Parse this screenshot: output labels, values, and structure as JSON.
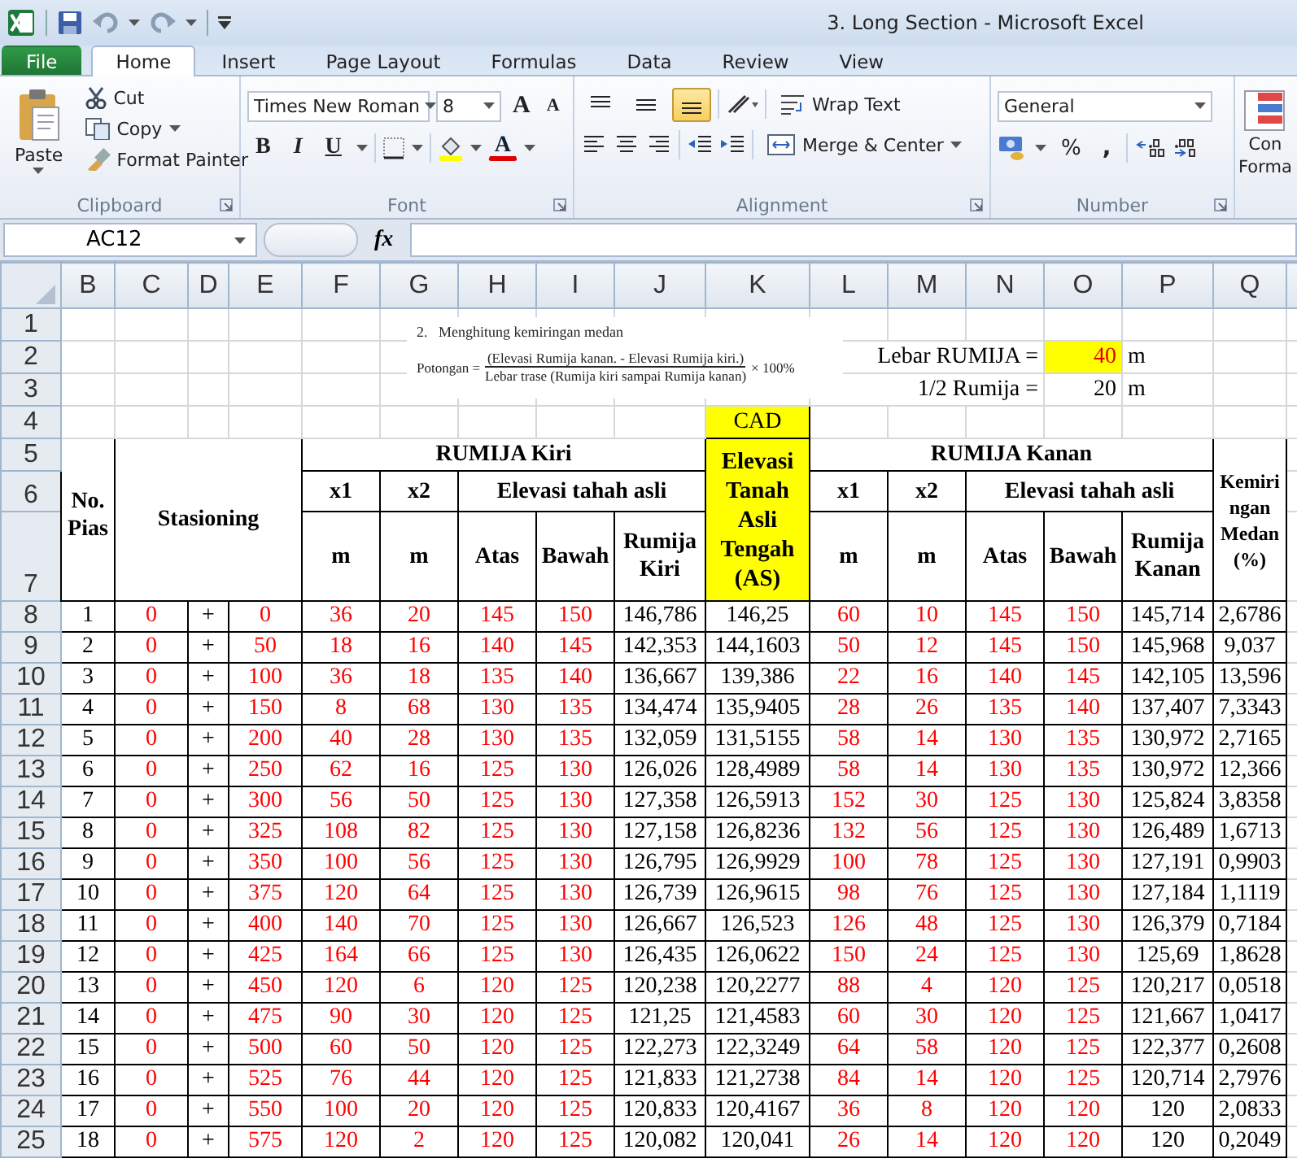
{
  "window": {
    "title": "3. Long Section  -  Microsoft Excel"
  },
  "menu_tabs": [
    {
      "label": "File",
      "kind": "file",
      "selected": false
    },
    {
      "label": "Home",
      "kind": "tab",
      "selected": true
    },
    {
      "label": "Insert",
      "kind": "tab",
      "selected": false
    },
    {
      "label": "Page Layout",
      "kind": "tab",
      "selected": false
    },
    {
      "label": "Formulas",
      "kind": "tab",
      "selected": false
    },
    {
      "label": "Data",
      "kind": "tab",
      "selected": false
    },
    {
      "label": "Review",
      "kind": "tab",
      "selected": false
    },
    {
      "label": "View",
      "kind": "tab",
      "selected": false
    }
  ],
  "ribbon": {
    "clipboard": {
      "label": "Clipboard",
      "paste": "Paste",
      "cut": "Cut",
      "copy": "Copy",
      "format_painter": "Format Painter"
    },
    "font": {
      "label": "Font",
      "font_name": "Times New Roman",
      "font_size": "8",
      "grow": "A",
      "shrink": "A",
      "styles": [
        {
          "kind": "bold",
          "label": "B"
        },
        {
          "kind": "italic",
          "label": "I"
        },
        {
          "kind": "underline",
          "label": "U"
        }
      ],
      "font_color": "A"
    },
    "alignment": {
      "label": "Alignment",
      "vertical": [
        {
          "kind": "top",
          "selected": false
        },
        {
          "kind": "middle",
          "selected": false
        },
        {
          "kind": "bottom",
          "selected": true
        }
      ],
      "wrap_text": "Wrap Text",
      "merge_center": "Merge & Center"
    },
    "number": {
      "label": "Number",
      "format": "General",
      "percent": "%",
      "comma": ","
    },
    "styles": {
      "conditional_lines": [
        "Con",
        "Forma"
      ]
    }
  },
  "formula_bar": {
    "name_box": "AC12",
    "function_label": "fx"
  },
  "sheet": {
    "columns": [
      {
        "letter": "B",
        "color": "#000000"
      },
      {
        "letter": "C",
        "color": "#ff0000"
      },
      {
        "letter": "D",
        "color": "#000000"
      },
      {
        "letter": "E",
        "color": "#ff0000"
      },
      {
        "letter": "F",
        "color": "#ff0000"
      },
      {
        "letter": "G",
        "color": "#ff0000"
      },
      {
        "letter": "H",
        "color": "#ff0000"
      },
      {
        "letter": "I",
        "color": "#ff0000"
      },
      {
        "letter": "J",
        "color": "#000000"
      },
      {
        "letter": "K",
        "color": "#000000"
      },
      {
        "letter": "L",
        "color": "#ff0000"
      },
      {
        "letter": "M",
        "color": "#ff0000"
      },
      {
        "letter": "N",
        "color": "#ff0000"
      },
      {
        "letter": "O",
        "color": "#ff0000"
      },
      {
        "letter": "P",
        "color": "#000000"
      },
      {
        "letter": "Q",
        "color": "#000000"
      }
    ],
    "row_numbers": [
      "1",
      "2",
      "3",
      "4",
      "5",
      "6",
      "7",
      "8",
      "9",
      "10",
      "11",
      "12",
      "13",
      "14",
      "15",
      "16",
      "17",
      "18",
      "19",
      "20",
      "21",
      "22",
      "23",
      "24",
      "25"
    ],
    "formula_picture": {
      "heading": "2.   Menghitung kemiringan medan",
      "lhs": "Potongan =",
      "numerator": "(Elevasi Rumija kanan. - Elevasi Rumija kiri.)",
      "denominator": "Lebar trase (Rumija kiri sampai Rumija kanan)",
      "factor": "× 100%"
    },
    "parameters": [
      {
        "label": "Lebar RUMIJA =",
        "value": "40",
        "unit": "m",
        "highlighted": true
      },
      {
        "label": "1/2 Rumija =",
        "value": "20",
        "unit": "m",
        "highlighted": false
      }
    ],
    "cad_label": "CAD",
    "header": {
      "no": "No. Pias",
      "station": "Stasioning",
      "left_group": "RUMIJA Kiri",
      "right_group": "RUMIJA Kanan",
      "x1_left": "x1",
      "x2_left": "x2",
      "x1_right": "x1",
      "x2_right": "x2",
      "elevation_left": "Elevasi tahah asli",
      "elevation_right": "Elevasi tahah asli",
      "unit_left_x1": "m",
      "unit_left_x2": "m",
      "unit_right_x1": "m",
      "unit_right_x2": "m",
      "top_left": "Atas",
      "bottom_left": "Bawah",
      "rumija_left": "Rumija Kiri",
      "top_right": "Atas",
      "bottom_right": "Bawah",
      "rumija_right": "Rumija Kanan",
      "center": "Elevasi Tanah Asli Tengah (AS)",
      "center_highlighted": true,
      "slope": "Kemiringan Medan (%)"
    },
    "rows": [
      [
        "1",
        "0",
        "+",
        "0",
        "36",
        "20",
        "145",
        "150",
        "146,786",
        "146,25",
        "60",
        "10",
        "145",
        "150",
        "145,714",
        "2,6786"
      ],
      [
        "2",
        "0",
        "+",
        "50",
        "18",
        "16",
        "140",
        "145",
        "142,353",
        "144,1603",
        "50",
        "12",
        "145",
        "150",
        "145,968",
        "9,037"
      ],
      [
        "3",
        "0",
        "+",
        "100",
        "36",
        "18",
        "135",
        "140",
        "136,667",
        "139,386",
        "22",
        "16",
        "140",
        "145",
        "142,105",
        "13,596"
      ],
      [
        "4",
        "0",
        "+",
        "150",
        "8",
        "68",
        "130",
        "135",
        "134,474",
        "135,9405",
        "28",
        "26",
        "135",
        "140",
        "137,407",
        "7,3343"
      ],
      [
        "5",
        "0",
        "+",
        "200",
        "40",
        "28",
        "130",
        "135",
        "132,059",
        "131,5155",
        "58",
        "14",
        "130",
        "135",
        "130,972",
        "2,7165"
      ],
      [
        "6",
        "0",
        "+",
        "250",
        "62",
        "16",
        "125",
        "130",
        "126,026",
        "128,4989",
        "58",
        "14",
        "130",
        "135",
        "130,972",
        "12,366"
      ],
      [
        "7",
        "0",
        "+",
        "300",
        "56",
        "50",
        "125",
        "130",
        "127,358",
        "126,5913",
        "152",
        "30",
        "125",
        "130",
        "125,824",
        "3,8358"
      ],
      [
        "8",
        "0",
        "+",
        "325",
        "108",
        "82",
        "125",
        "130",
        "127,158",
        "126,8236",
        "132",
        "56",
        "125",
        "130",
        "126,489",
        "1,6713"
      ],
      [
        "9",
        "0",
        "+",
        "350",
        "100",
        "56",
        "125",
        "130",
        "126,795",
        "126,9929",
        "100",
        "78",
        "125",
        "130",
        "127,191",
        "0,9903"
      ],
      [
        "10",
        "0",
        "+",
        "375",
        "120",
        "64",
        "125",
        "130",
        "126,739",
        "126,9615",
        "98",
        "76",
        "125",
        "130",
        "127,184",
        "1,1119"
      ],
      [
        "11",
        "0",
        "+",
        "400",
        "140",
        "70",
        "125",
        "130",
        "126,667",
        "126,523",
        "126",
        "48",
        "125",
        "130",
        "126,379",
        "0,7184"
      ],
      [
        "12",
        "0",
        "+",
        "425",
        "164",
        "66",
        "125",
        "130",
        "126,435",
        "126,0622",
        "150",
        "24",
        "125",
        "130",
        "125,69",
        "1,8628"
      ],
      [
        "13",
        "0",
        "+",
        "450",
        "120",
        "6",
        "120",
        "125",
        "120,238",
        "120,2277",
        "88",
        "4",
        "120",
        "125",
        "120,217",
        "0,0518"
      ],
      [
        "14",
        "0",
        "+",
        "475",
        "90",
        "30",
        "120",
        "125",
        "121,25",
        "121,4583",
        "60",
        "30",
        "120",
        "125",
        "121,667",
        "1,0417"
      ],
      [
        "15",
        "0",
        "+",
        "500",
        "60",
        "50",
        "120",
        "125",
        "122,273",
        "122,3249",
        "64",
        "58",
        "120",
        "125",
        "122,377",
        "0,2608"
      ],
      [
        "16",
        "0",
        "+",
        "525",
        "76",
        "44",
        "120",
        "125",
        "121,833",
        "121,2738",
        "84",
        "14",
        "120",
        "125",
        "120,714",
        "2,7976"
      ],
      [
        "17",
        "0",
        "+",
        "550",
        "100",
        "20",
        "120",
        "125",
        "120,833",
        "120,4167",
        "36",
        "8",
        "120",
        "120",
        "120",
        "2,0833"
      ],
      [
        "18",
        "0",
        "+",
        "575",
        "120",
        "2",
        "120",
        "125",
        "120,082",
        "120,041",
        "26",
        "14",
        "120",
        "120",
        "120",
        "0,2049"
      ]
    ]
  }
}
